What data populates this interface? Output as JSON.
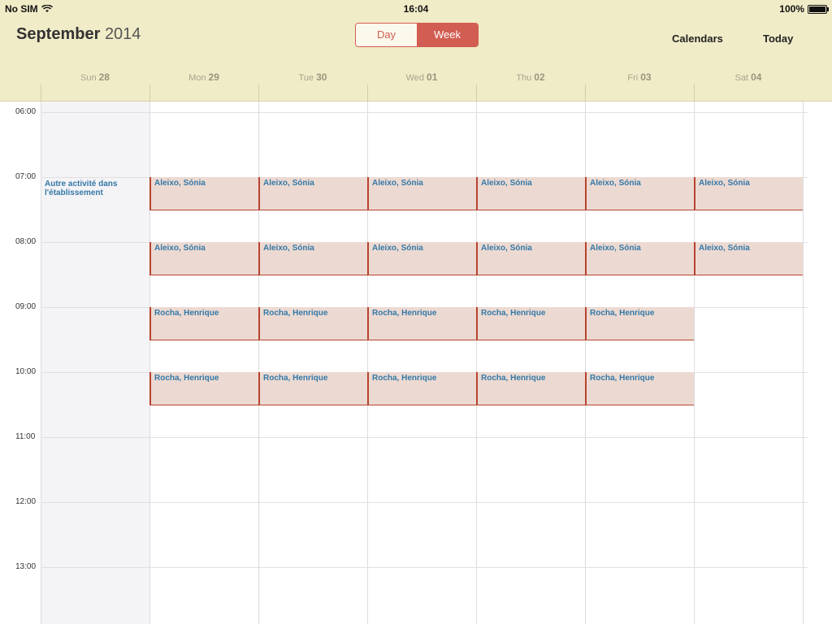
{
  "status_bar": {
    "carrier": "No SIM",
    "time": "16:04",
    "battery": "100%"
  },
  "header": {
    "month": "September",
    "year": "2014",
    "segment": {
      "day_label": "Day",
      "week_label": "Week",
      "selected": "Week"
    },
    "calendars_label": "Calendars",
    "today_label": "Today"
  },
  "days": [
    {
      "name": "Sun",
      "num": "28"
    },
    {
      "name": "Mon",
      "num": "29"
    },
    {
      "name": "Tue",
      "num": "30"
    },
    {
      "name": "Wed",
      "num": "01"
    },
    {
      "name": "Thu",
      "num": "02"
    },
    {
      "name": "Fri",
      "num": "03"
    },
    {
      "name": "Sat",
      "num": "04"
    }
  ],
  "time_labels": [
    "06:00",
    "07:00",
    "08:00",
    "09:00",
    "10:00",
    "11:00",
    "12:00",
    "13:00"
  ],
  "sunday_event": "Autre activité dans l'établissement",
  "events": [
    {
      "day": 1,
      "start": 7,
      "title": "Aleixo, Sónia"
    },
    {
      "day": 2,
      "start": 7,
      "title": "Aleixo, Sónia"
    },
    {
      "day": 3,
      "start": 7,
      "title": "Aleixo, Sónia"
    },
    {
      "day": 4,
      "start": 7,
      "title": "Aleixo, Sónia"
    },
    {
      "day": 5,
      "start": 7,
      "title": "Aleixo, Sónia"
    },
    {
      "day": 6,
      "start": 7,
      "title": "Aleixo, Sónia"
    },
    {
      "day": 1,
      "start": 8,
      "title": "Aleixo, Sónia"
    },
    {
      "day": 2,
      "start": 8,
      "title": "Aleixo, Sónia"
    },
    {
      "day": 3,
      "start": 8,
      "title": "Aleixo, Sónia"
    },
    {
      "day": 4,
      "start": 8,
      "title": "Aleixo, Sónia"
    },
    {
      "day": 5,
      "start": 8,
      "title": "Aleixo, Sónia"
    },
    {
      "day": 6,
      "start": 8,
      "title": "Aleixo, Sónia"
    },
    {
      "day": 1,
      "start": 9,
      "title": "Rocha, Henrique"
    },
    {
      "day": 2,
      "start": 9,
      "title": "Rocha, Henrique"
    },
    {
      "day": 3,
      "start": 9,
      "title": "Rocha, Henrique"
    },
    {
      "day": 4,
      "start": 9,
      "title": "Rocha, Henrique"
    },
    {
      "day": 5,
      "start": 9,
      "title": "Rocha, Henrique"
    },
    {
      "day": 1,
      "start": 10,
      "title": "Rocha, Henrique"
    },
    {
      "day": 2,
      "start": 10,
      "title": "Rocha, Henrique"
    },
    {
      "day": 3,
      "start": 10,
      "title": "Rocha, Henrique"
    },
    {
      "day": 4,
      "start": 10,
      "title": "Rocha, Henrique"
    },
    {
      "day": 5,
      "start": 10,
      "title": "Rocha, Henrique"
    }
  ]
}
